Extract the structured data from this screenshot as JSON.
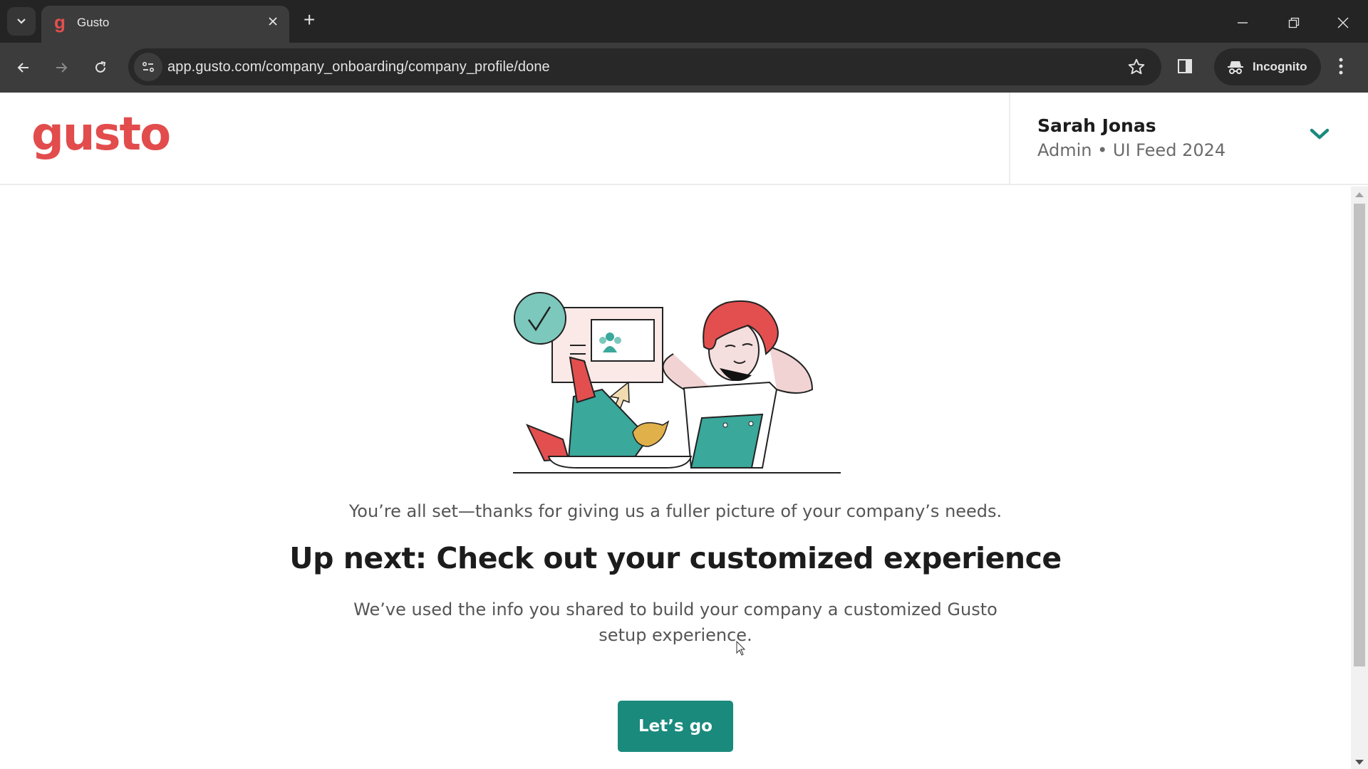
{
  "browser": {
    "tab": {
      "title": "Gusto",
      "favicon": "g"
    },
    "new_tab_icon": "+",
    "url": "app.gusto.com/company_onboarding/company_profile/done",
    "incognito_label": "Incognito"
  },
  "header": {
    "logo": "gusto",
    "user": {
      "name": "Sarah Jonas",
      "subtitle": "Admin • UI Feed 2024"
    }
  },
  "main": {
    "intro": "You’re all set—thanks for giving us a fuller picture of your company’s needs.",
    "heading": "Up next: Check out your customized experience",
    "description": "We’ve used the info you shared to build your company a customized Gusto setup experience.",
    "cta_label": "Let’s go"
  },
  "colors": {
    "brand": "#e24c4c",
    "accent": "#1a8a7d",
    "chevron": "#1a8a7d"
  }
}
